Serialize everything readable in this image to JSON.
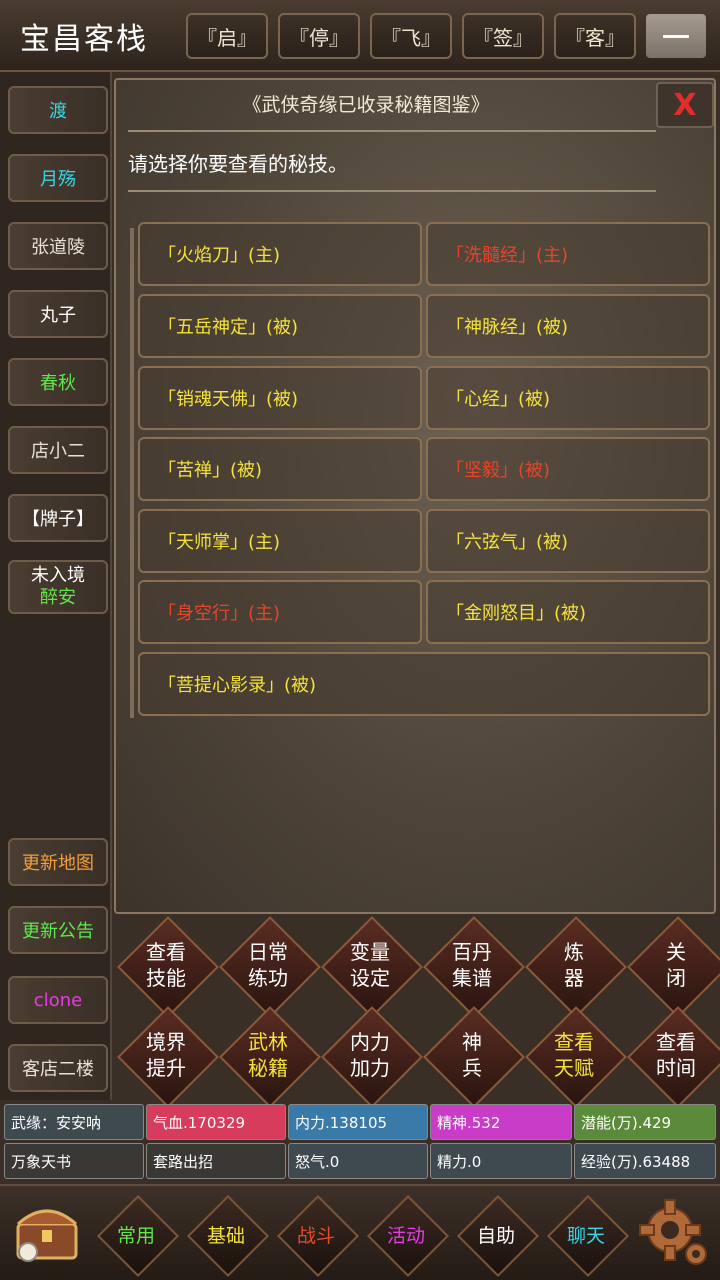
{
  "header": {
    "title": "宝昌客栈",
    "tabs": [
      "『启』",
      "『停』",
      "『飞』",
      "『签』",
      "『客』"
    ]
  },
  "sidebar": {
    "items": [
      {
        "label": "渡",
        "color": "#37d6e6"
      },
      {
        "label": "月殇",
        "color": "#37d6e6"
      },
      {
        "label": "张道陵",
        "color": "#e8e0d0"
      },
      {
        "label": "丸子",
        "color": "#ffffff"
      },
      {
        "label": "春秋",
        "color": "#5ee84a"
      },
      {
        "label": "店小二",
        "color": "#e8e0d0"
      },
      {
        "label": "【牌子】",
        "color": "#ffffff"
      }
    ],
    "realm": {
      "line1": "未入境",
      "line2": "醉安"
    },
    "bottom_items": [
      {
        "label": "更新地图",
        "color": "#f0a03a"
      },
      {
        "label": "更新公告",
        "color": "#5ee84a"
      },
      {
        "label": "clone",
        "color": "#e83ae8"
      },
      {
        "label": "客店二楼",
        "color": "#e8e0d0"
      }
    ]
  },
  "dialog": {
    "title": "《武侠奇缘已收录秘籍图鉴》",
    "close_label": "X",
    "prompt": "请选择你要查看的秘技。",
    "skills": [
      {
        "label": "「火焰刀」(主)",
        "color": "yellow"
      },
      {
        "label": "「洗髓经」(主)",
        "color": "red"
      },
      {
        "label": "「五岳神定」(被)",
        "color": "yellow"
      },
      {
        "label": "「神脉经」(被)",
        "color": "yellow"
      },
      {
        "label": "「销魂天佛」(被)",
        "color": "yellow"
      },
      {
        "label": "「心经」(被)",
        "color": "yellow"
      },
      {
        "label": "「苦禅」(被)",
        "color": "yellow"
      },
      {
        "label": "「坚毅」(被)",
        "color": "red"
      },
      {
        "label": "「天师掌」(主)",
        "color": "yellow"
      },
      {
        "label": "「六弦气」(被)",
        "color": "yellow"
      },
      {
        "label": "「身空行」(主)",
        "color": "red"
      },
      {
        "label": "「金刚怒目」(被)",
        "color": "yellow"
      },
      {
        "label": "「菩提心影录」(被)",
        "color": "yellow"
      }
    ]
  },
  "actions": [
    {
      "l1": "查看",
      "l2": "技能",
      "hl": false
    },
    {
      "l1": "日常",
      "l2": "练功",
      "hl": false
    },
    {
      "l1": "变量",
      "l2": "设定",
      "hl": false
    },
    {
      "l1": "百丹",
      "l2": "集谱",
      "hl": false
    },
    {
      "l1": "炼",
      "l2": "器",
      "hl": false
    },
    {
      "l1": "关",
      "l2": "闭",
      "hl": false
    },
    {
      "l1": "境界",
      "l2": "提升",
      "hl": false
    },
    {
      "l1": "武林",
      "l2": "秘籍",
      "hl": true
    },
    {
      "l1": "内力",
      "l2": "加力",
      "hl": false
    },
    {
      "l1": "神",
      "l2": "兵",
      "hl": false
    },
    {
      "l1": "查看",
      "l2": "天赋",
      "hl": true
    },
    {
      "l1": "查看",
      "l2": "时间",
      "hl": false
    }
  ],
  "stats": {
    "row1": [
      {
        "label": "武缘：安安呐",
        "bg": "#3f4a4e"
      },
      {
        "label": "气血.170329",
        "bg": "#d83c5c"
      },
      {
        "label": "内力.138105",
        "bg": "#3a7aa8"
      },
      {
        "label": "精神.532",
        "bg": "#c83cc8"
      },
      {
        "label": "潜能(万).429",
        "bg": "#5a8a3a"
      }
    ],
    "row2": [
      {
        "label": "万象天书",
        "bg": "#3a3835"
      },
      {
        "label": "套路出招",
        "bg": "#3a3835"
      },
      {
        "label": "怒气.0",
        "bg": "#3e4a50"
      },
      {
        "label": "精力.0",
        "bg": "#3e4a50"
      },
      {
        "label": "经验(万).63488",
        "bg": "#3e4a50"
      }
    ]
  },
  "bottom_nav": [
    {
      "label": "常用",
      "color": "#5ee84a"
    },
    {
      "label": "基础",
      "color": "#f5e23a"
    },
    {
      "label": "战斗",
      "color": "#e84a2a"
    },
    {
      "label": "活动",
      "color": "#e83ae8"
    },
    {
      "label": "自助",
      "color": "#ffffff"
    },
    {
      "label": "聊天",
      "color": "#37d6e6"
    }
  ],
  "icons": {
    "chest": "treasure-chest-icon",
    "settings": "gear-icon",
    "menu": "hamburger-icon"
  }
}
